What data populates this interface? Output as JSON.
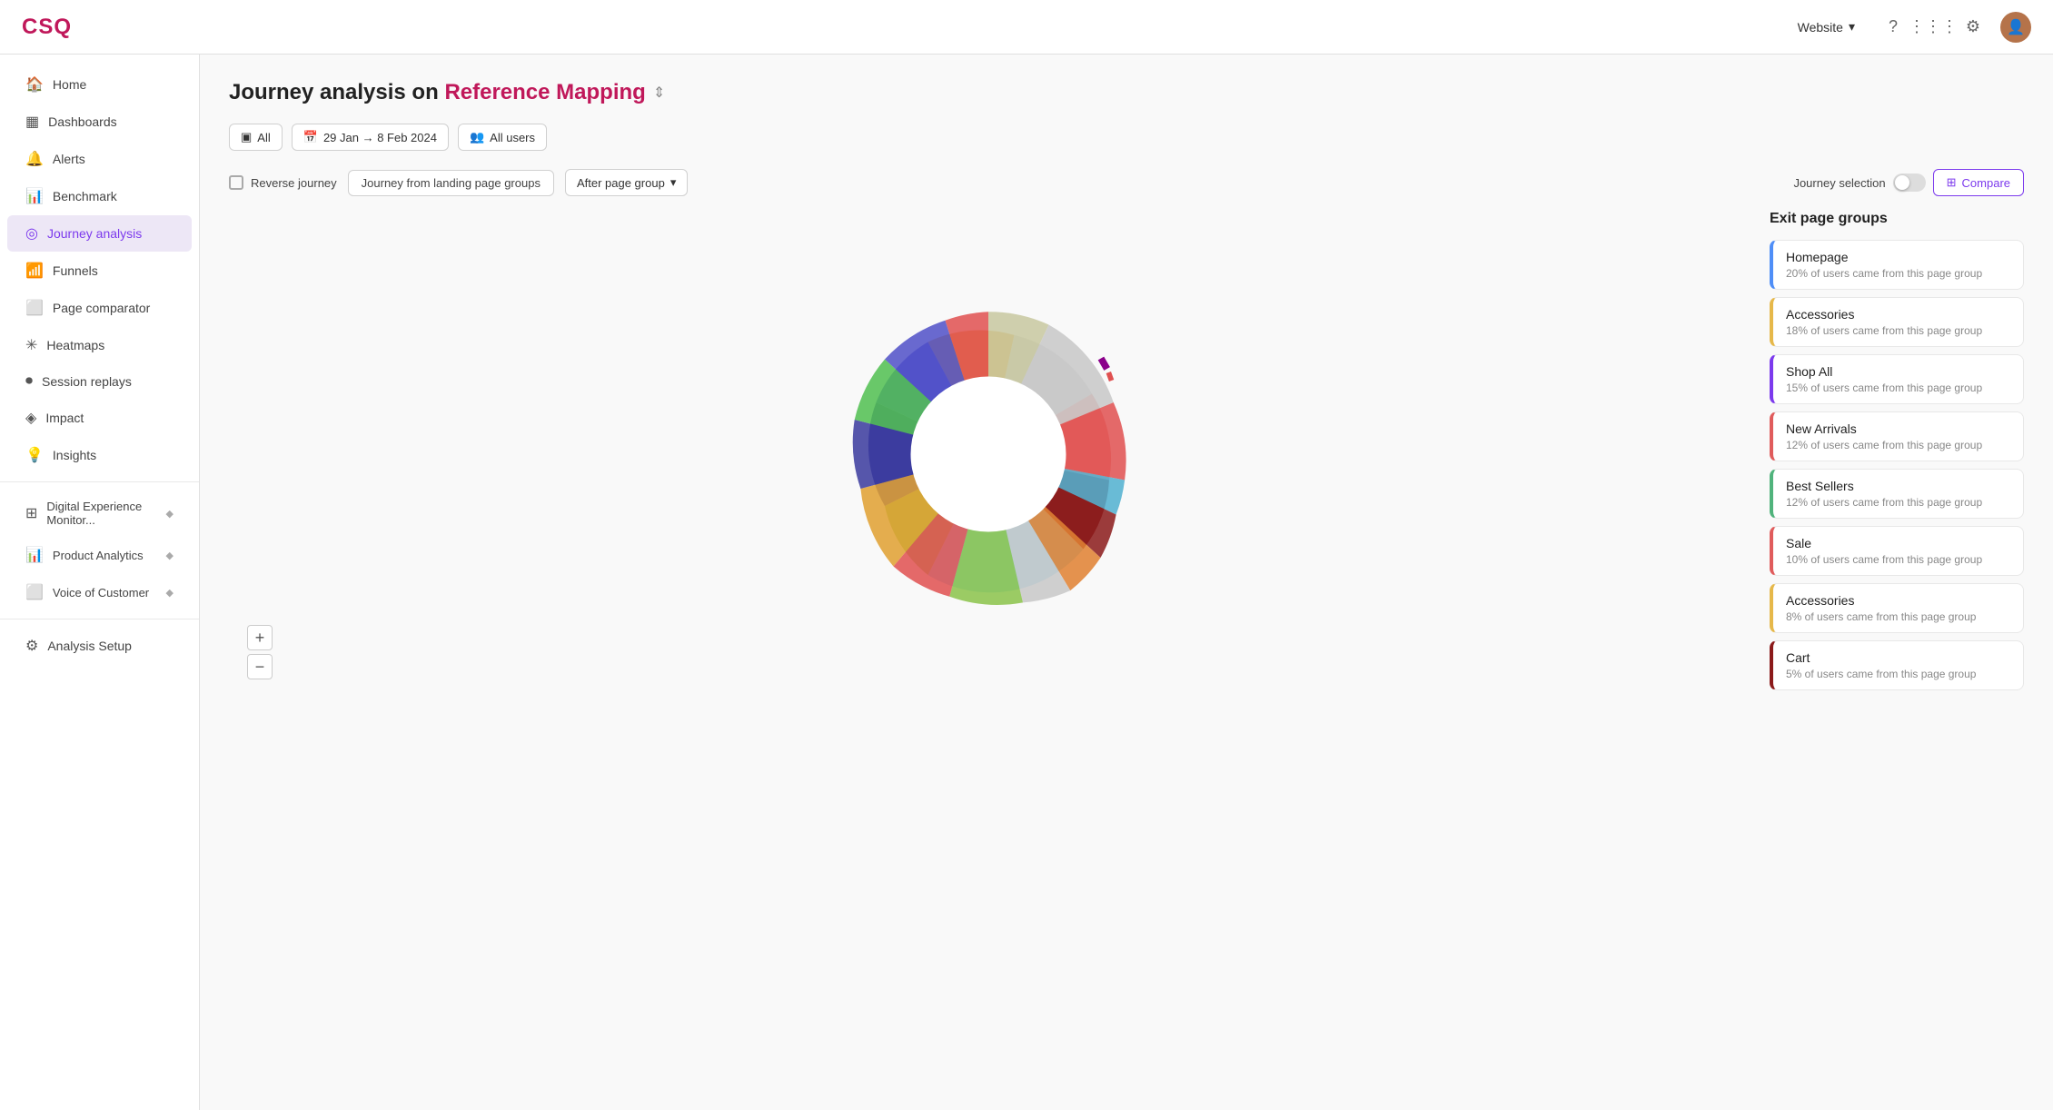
{
  "logo": "CSQ",
  "topnav": {
    "website_label": "Website",
    "chevron": "▾"
  },
  "sidebar": {
    "items": [
      {
        "id": "home",
        "label": "Home",
        "icon": "🏠",
        "active": false
      },
      {
        "id": "dashboards",
        "label": "Dashboards",
        "icon": "▦",
        "active": false
      },
      {
        "id": "alerts",
        "label": "Alerts",
        "icon": "🔔",
        "active": false
      },
      {
        "id": "benchmark",
        "label": "Benchmark",
        "icon": "📊",
        "active": false
      },
      {
        "id": "journey-analysis",
        "label": "Journey analysis",
        "icon": "◎",
        "active": true
      },
      {
        "id": "funnels",
        "label": "Funnels",
        "icon": "📶",
        "active": false
      },
      {
        "id": "page-comparator",
        "label": "Page comparator",
        "icon": "⬜",
        "active": false
      },
      {
        "id": "heatmaps",
        "label": "Heatmaps",
        "icon": "✳",
        "active": false
      },
      {
        "id": "session-replays",
        "label": "Session replays",
        "icon": "⏺",
        "active": false
      },
      {
        "id": "impact",
        "label": "Impact",
        "icon": "◈",
        "active": false
      },
      {
        "id": "insights",
        "label": "Insights",
        "icon": "💡",
        "active": false
      }
    ],
    "secondary_items": [
      {
        "id": "digital-experience",
        "label": "Digital Experience Monitor...",
        "icon": "⊞",
        "badge": "◆"
      },
      {
        "id": "product-analytics",
        "label": "Product Analytics",
        "icon": "📊",
        "badge": "◆"
      },
      {
        "id": "voice-of-customer",
        "label": "Voice of Customer",
        "icon": "⬜",
        "badge": "◆"
      }
    ],
    "tertiary_items": [
      {
        "id": "analysis-setup",
        "label": "Analysis Setup",
        "icon": "⚙"
      }
    ]
  },
  "page": {
    "title": "Journey analysis on",
    "reference": "Reference Mapping",
    "chevron": "⇕"
  },
  "filters": {
    "all_label": "All",
    "all_icon": "▣",
    "date_label": "29 Jan → 8 Feb 2024",
    "date_icon": "📅",
    "users_label": "All users",
    "users_icon": "👥"
  },
  "journey_controls": {
    "reverse_label": "Reverse journey",
    "from_label": "Journey from landing page groups",
    "after_label": "After page group",
    "after_chevron": "▾",
    "selection_label": "Journey selection",
    "compare_label": "Compare",
    "compare_icon": "⊞"
  },
  "exit_panel": {
    "title": "Exit page groups",
    "items": [
      {
        "name": "Homepage",
        "desc": "20% of users came from this page group",
        "color_class": "exit-item-0"
      },
      {
        "name": "Accessories",
        "desc": "18% of users came from this page group",
        "color_class": "exit-item-1"
      },
      {
        "name": "Shop All",
        "desc": "15% of users came from this page group",
        "color_class": "exit-item-2"
      },
      {
        "name": "New Arrivals",
        "desc": "12% of users came from this page group",
        "color_class": "exit-item-3"
      },
      {
        "name": "Best Sellers",
        "desc": "12% of users came from this page group",
        "color_class": "exit-item-4"
      },
      {
        "name": "Sale",
        "desc": "10% of users came from this page group",
        "color_class": "exit-item-5"
      },
      {
        "name": "Accessories",
        "desc": "8% of users came from this page group",
        "color_class": "exit-item-6"
      },
      {
        "name": "Cart",
        "desc": "5% of users came from this page group",
        "color_class": "exit-item-7"
      }
    ]
  },
  "zoom": {
    "in": "+",
    "out": "−"
  }
}
